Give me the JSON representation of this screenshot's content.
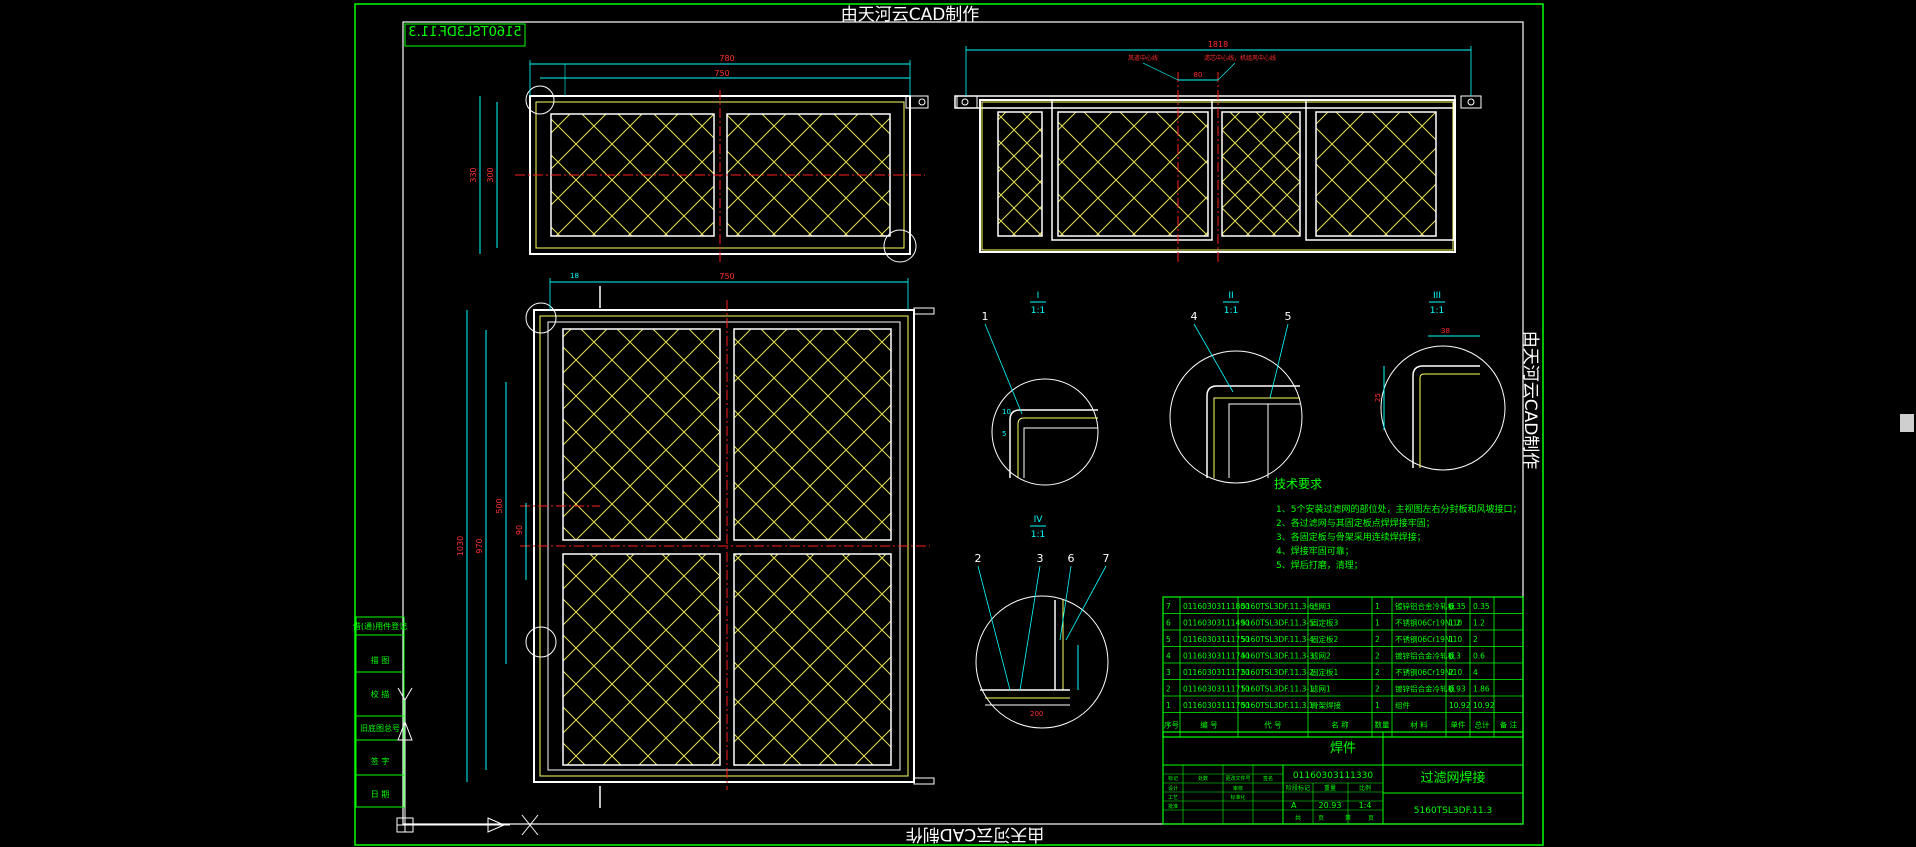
{
  "watermark": "由天河云CAD制作",
  "drawing_no_stamp": "5160TSL3DF.11.3",
  "tech_requirements": {
    "title": "技术要求",
    "items": [
      "1、5个安装过滤网的部位处，主视图左右分封板和风坡接口；",
      "2、各过滤网与其固定板点焊焊接牢固；",
      "3、各固定板与骨架采用连续焊焊接；",
      "4、焊接牢固可靠；",
      "5、焊后打磨，清理；"
    ]
  },
  "section_labels": [
    {
      "id": "I",
      "ratio": "1:1"
    },
    {
      "id": "II",
      "ratio": "1:1"
    },
    {
      "id": "III",
      "ratio": "1:1"
    },
    {
      "id": "IV",
      "ratio": "1:1"
    }
  ],
  "callouts": [
    "1",
    "4",
    "5",
    "2",
    "3",
    "6",
    "7"
  ],
  "dimensions": {
    "top_width_overall": "780",
    "top_width_inner": "750",
    "side_width": "1818",
    "side_center_gap": "80",
    "side_note_left": "风道中心线",
    "side_note_right": "滤芯中心线，机组风中心线",
    "front_width": "750",
    "front_height": "1030",
    "d_18": "18",
    "d_38": "38",
    "d_200": "200",
    "d_5": "5",
    "d_10": "10",
    "d_25": "25"
  },
  "bom": {
    "rows": [
      [
        "7",
        "01160303111800",
        "5160TSL3DF.11.3-6",
        "滤网3",
        "1",
        "镀锌铝合金冷轧板",
        "0.35",
        "0.35",
        ""
      ],
      [
        "6",
        "01160303111490",
        "5160TSL3DF.11.3-5",
        "固定板3",
        "1",
        "不锈钢06Cr19Ni10",
        "1.2",
        "1.2",
        ""
      ],
      [
        "5",
        "01160303111750",
        "5160TSL3DF.11.3-4",
        "固定板2",
        "2",
        "不锈钢06Cr19Ni10",
        "1",
        "2",
        ""
      ],
      [
        "4",
        "01160303111740",
        "5160TSL3DF.11.3-3",
        "滤网2",
        "2",
        "镀锌铝合金冷轧板",
        "0.3",
        "0.6",
        ""
      ],
      [
        "3",
        "01160303111720",
        "5160TSL3DF.11.3-2",
        "固定板1",
        "2",
        "不锈钢06Cr19Ni10",
        "2",
        "4",
        ""
      ],
      [
        "2",
        "01160303111710",
        "5160TSL3DF.11.3-1",
        "滤网1",
        "2",
        "镀锌铝合金冷轧板",
        "0.93",
        "1.86",
        ""
      ],
      [
        "1",
        "01160303111700",
        "5160TSL3DF.11.3.1",
        "骨架焊接",
        "1",
        "组件",
        "10.92",
        "10.92",
        ""
      ]
    ],
    "headers": [
      "序号",
      "编 号",
      "代 号",
      "名 称",
      "数量",
      "材 料",
      "单件",
      "总计",
      "备 注"
    ],
    "weight_header": "重 量"
  },
  "title_block": {
    "part_type": "焊件",
    "part_code": "01160303111330",
    "part_name": "过滤网焊接",
    "drawing_no": "5160TSL3DF.11.3",
    "stage": "A",
    "weight": "20.93",
    "scale": "1:4",
    "labels": [
      "标记",
      "处数",
      "更改文件号",
      "签名",
      "日期"
    ],
    "roles": [
      "设计",
      "审核",
      "工艺",
      "标准化",
      "批准"
    ],
    "stage_labels": [
      "阶段标记",
      "重量",
      "比例"
    ],
    "sheet_labels": [
      "共",
      "页",
      "第",
      "页"
    ]
  },
  "left_strip": [
    "借(通)用件登记",
    "描 图",
    "校 描",
    "旧底图总号",
    "签 字",
    "日 期"
  ],
  "colors": {
    "frame": "#00ff00",
    "dim": "#00ffff",
    "outline": "#ffffff",
    "mesh": "#ffff66",
    "center": "#ff2020",
    "table": "#00ff00",
    "text_red": "#ff3030"
  }
}
